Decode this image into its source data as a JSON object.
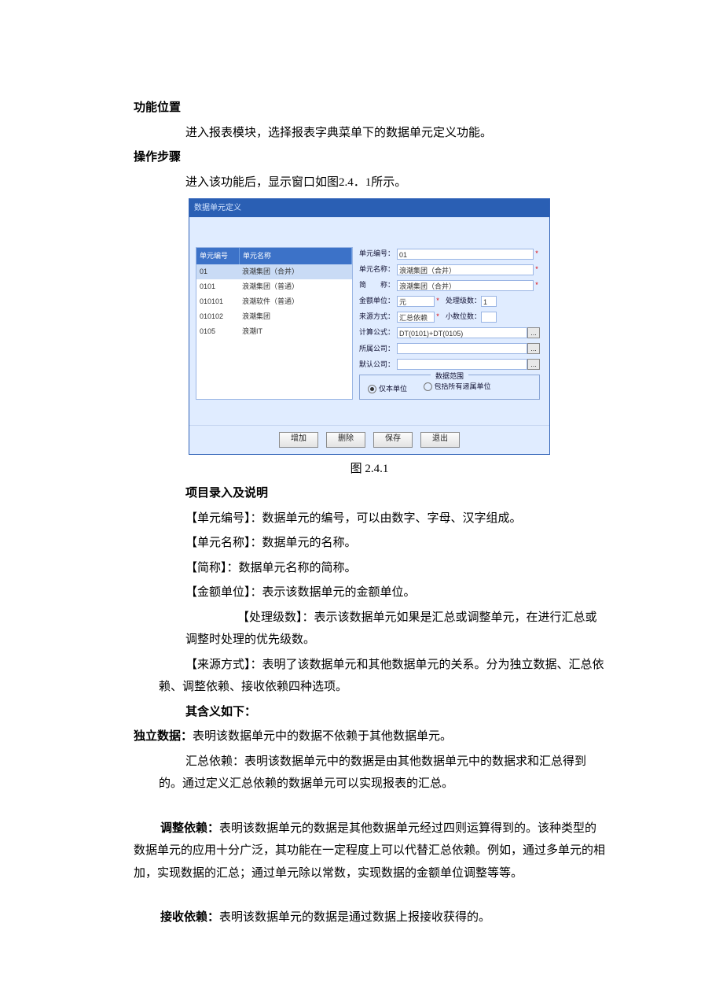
{
  "sections": {
    "pos_h": "功能位置",
    "pos_b": "进入报表模块，选择报表字典菜单下的数据单元定义功能。",
    "step_h": "操作步骤",
    "step_b": "进入该功能后，显示窗口如图2.4．1所示。",
    "fig_caption": "图 2.4.1",
    "entry_h": "项目录入及说明",
    "desc_id": "【单元编号】：数据单元的编号，可以由数字、字母、汉字组成。",
    "desc_name": "【单元名称】：数据单元的名称。",
    "desc_short": "【简称】：数据单元名称的简称。",
    "desc_unit": "【金额单位】：表示该数据单元的金额单位。",
    "desc_level": "【处理级数】：表示该数据单元如果是汇总或调整单元，在进行汇总或调整时处理的优先级数。",
    "desc_src": "【来源方式】：表明了该数据单元和其他数据单元的关系。分为独立数据、汇总依赖、调整依赖、接收依赖四种选项。",
    "mean_h": "其含义如下：",
    "mean_a_label": "独立数据：",
    "mean_a_text": "表明该数据单元中的数据不依赖于其他数据单元。",
    "mean_b": "汇总依赖：表明该数据单元中的数据是由其他数据单元中的数据求和汇总得到的。通过定义汇总依赖的数据单元可以实现报表的汇总。",
    "mean_c_label": "调整依赖：",
    "mean_c_text": "表明该数据单元的数据是其他数据单元经过四则运算得到的。该种类型的数据单元的应用十分广泛，其功能在一定程度上可以代替汇总依赖。例如，通过多单元的相加，实现数据的汇总；通过单元除以常数，实现数据的金额单位调整等等。",
    "mean_d_label": "接收依赖：",
    "mean_d_text": "表明该数据单元的数据是通过数据上报接收获得的。"
  },
  "dialog": {
    "title": "数据单元定义",
    "list_head": {
      "a": "单元编号",
      "b": "单元名称"
    },
    "rows": [
      {
        "a": "01",
        "b": "浪潮集团（合并）"
      },
      {
        "a": "0101",
        "b": "浪潮集团（普通）"
      },
      {
        "a": "010101",
        "b": "浪潮软件（普通）"
      },
      {
        "a": "010102",
        "b": "浪潮集团"
      },
      {
        "a": "0105",
        "b": "浪潮IT"
      }
    ],
    "form": {
      "l_id": "单元编号：",
      "v_id": "01",
      "l_name": "单元名称：",
      "v_name": "浪潮集团（合并）",
      "l_short": "简　　称：",
      "v_short": "浪潮集团（合并）",
      "l_unit": "金额单位：",
      "v_unit": "元",
      "l_level": "处理级数：",
      "v_level": "1",
      "l_src": "来源方式：",
      "v_src": "汇总依赖",
      "l_dec": "小数位数：",
      "v_dec": "",
      "l_formula": "计算公式：",
      "v_formula": "DT(0101)+DT(0105)",
      "l_comp": "所属公司：",
      "v_comp": "",
      "l_acct": "默认公司：",
      "v_acct": "",
      "btn_more": "...",
      "group_label": "数据范围",
      "radio_a": "仅本单位",
      "radio_b": "包括所有递属单位"
    },
    "buttons": {
      "add": "增加",
      "del": "删除",
      "save": "保存",
      "exit": "退出"
    }
  }
}
